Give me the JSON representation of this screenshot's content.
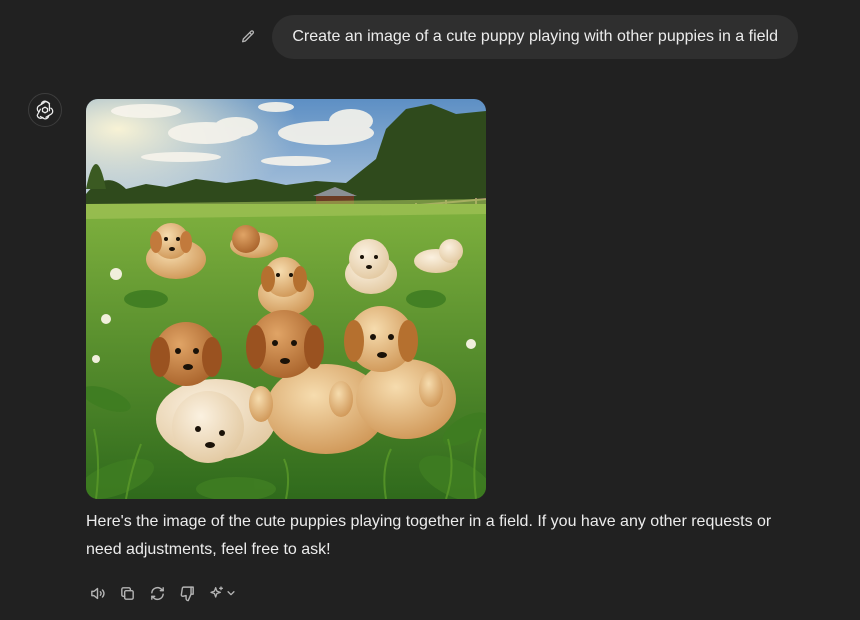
{
  "conversation": {
    "user_message": "Create an image of a cute puppy playing with other puppies in a field",
    "assistant_reply": "Here's the image of the cute puppies playing together in a field. If you have any other requests or need adjustments, feel free to ask!"
  },
  "icons": {
    "edit": "pencil-icon",
    "avatar": "openai-logo-icon",
    "actions": [
      "read-aloud-icon",
      "copy-icon",
      "regenerate-icon",
      "thumbs-down-icon",
      "sparkle-icon",
      "chevron-down-icon"
    ]
  },
  "colors": {
    "background": "#212121",
    "bubble": "#2f2f2f",
    "text": "#ececec",
    "icon": "#b4b4b4"
  }
}
